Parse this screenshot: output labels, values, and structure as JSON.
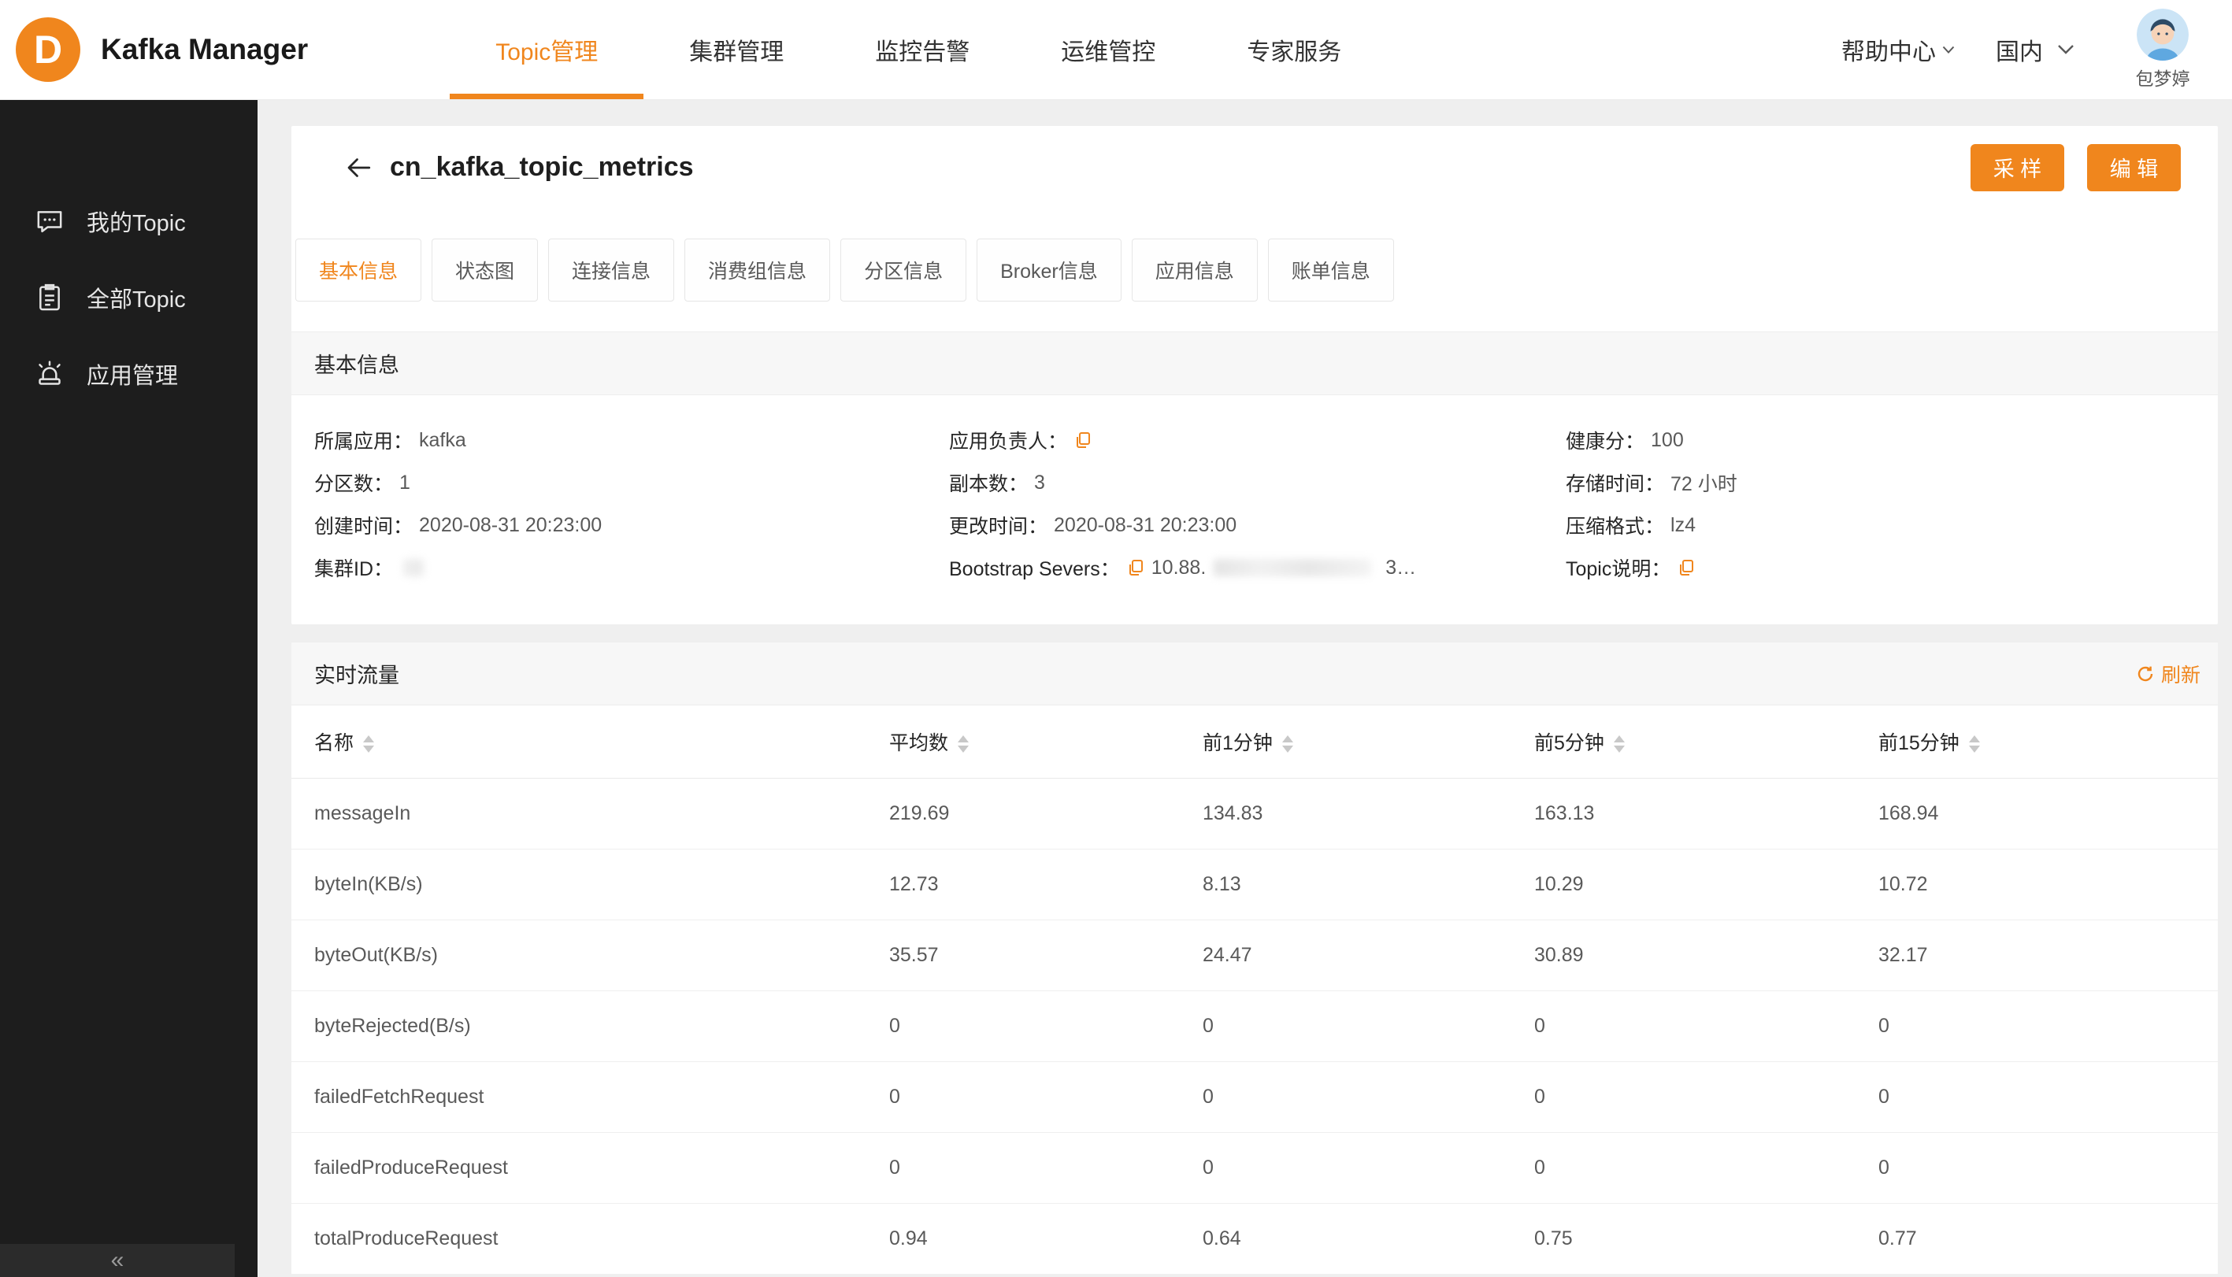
{
  "colors": {
    "accent": "#F0861D",
    "sidebar_bg": "#1D1D1D",
    "page_bg": "#EFEFEF"
  },
  "header": {
    "app_title": "Kafka Manager",
    "logo_letter": "D",
    "nav": [
      {
        "label": "Topic管理"
      },
      {
        "label": "集群管理"
      },
      {
        "label": "监控告警"
      },
      {
        "label": "运维管控"
      },
      {
        "label": "专家服务"
      }
    ],
    "help_center": "帮助中心",
    "region": "国内",
    "user_name": "包梦婷"
  },
  "sidebar": {
    "items": [
      {
        "label": "我的Topic"
      },
      {
        "label": "全部Topic"
      },
      {
        "label": "应用管理"
      }
    ],
    "collapse_icon": "«"
  },
  "topic_page": {
    "title": "cn_kafka_topic_metrics",
    "sample_button": "采 样",
    "edit_button": "编 辑",
    "tabs": [
      {
        "label": "基本信息"
      },
      {
        "label": "状态图"
      },
      {
        "label": "连接信息"
      },
      {
        "label": "消费组信息"
      },
      {
        "label": "分区信息"
      },
      {
        "label": "Broker信息"
      },
      {
        "label": "应用信息"
      },
      {
        "label": "账单信息"
      }
    ],
    "basic_info": {
      "section_title": "基本信息",
      "fields": [
        {
          "label": "所属应用：",
          "value": "kafka"
        },
        {
          "label": "应用负责人：",
          "value": ""
        },
        {
          "label": "健康分：",
          "value": "100"
        },
        {
          "label": "分区数：",
          "value": "1"
        },
        {
          "label": "副本数：",
          "value": "3"
        },
        {
          "label": "存储时间：",
          "value": "72 小时"
        },
        {
          "label": "创建时间：",
          "value": "2020-08-31 20:23:00"
        },
        {
          "label": "更改时间：",
          "value": "2020-08-31 20:23:00"
        },
        {
          "label": "压缩格式：",
          "value": "lz4"
        },
        {
          "label": "集群ID：",
          "value": ""
        },
        {
          "label": "Bootstrap Severs：",
          "value": "10.88.",
          "value_tail": "3…"
        },
        {
          "label": "Topic说明：",
          "value": ""
        }
      ]
    },
    "realtime_traffic": {
      "section_title": "实时流量",
      "refresh_label": "刷新",
      "table": {
        "columns": [
          "名称",
          "平均数",
          "前1分钟",
          "前5分钟",
          "前15分钟"
        ],
        "rows": [
          {
            "name": "messageIn",
            "values": [
              "219.69",
              "134.83",
              "163.13",
              "168.94"
            ]
          },
          {
            "name": "byteIn(KB/s)",
            "values": [
              "12.73",
              "8.13",
              "10.29",
              "10.72"
            ]
          },
          {
            "name": "byteOut(KB/s)",
            "values": [
              "35.57",
              "24.47",
              "30.89",
              "32.17"
            ]
          },
          {
            "name": "byteRejected(B/s)",
            "values": [
              "0",
              "0",
              "0",
              "0"
            ]
          },
          {
            "name": "failedFetchRequest",
            "values": [
              "0",
              "0",
              "0",
              "0"
            ]
          },
          {
            "name": "failedProduceRequest",
            "values": [
              "0",
              "0",
              "0",
              "0"
            ]
          },
          {
            "name": "totalProduceRequest",
            "values": [
              "0.94",
              "0.64",
              "0.75",
              "0.77"
            ]
          }
        ]
      }
    }
  }
}
